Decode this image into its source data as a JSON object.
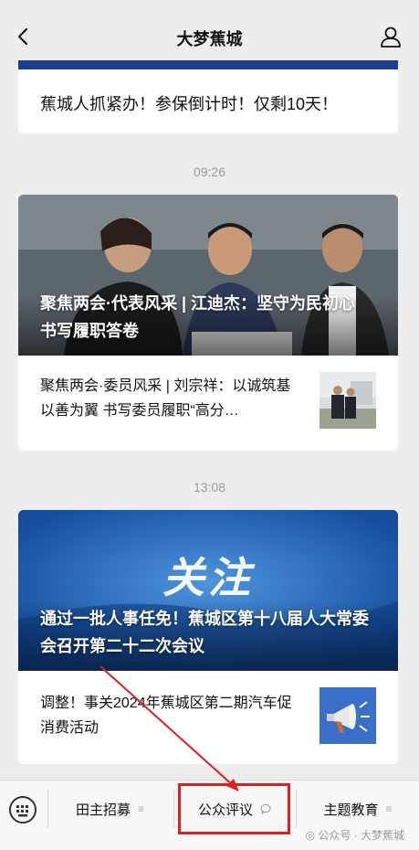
{
  "nav": {
    "title": "大梦蕉城"
  },
  "feed": {
    "top_card_title": "蕉城人抓紧办！参保倒计时！仅剩10天！",
    "groups": [
      {
        "time": "09:26",
        "cover_title": "聚焦两会·代表风采 | 江迪杰：坚守为民初心 书写履职答卷",
        "sub_title": "聚焦两会·委员风采 | 刘宗祥：以诚筑基 以善为翼 书写委员履职“高分…"
      },
      {
        "time": "13:08",
        "cover_badge": "关注",
        "cover_title": "通过一批人事任免！蕉城区第十八届人大常委会召开第二十二次会议",
        "sub_title": "调整！事关2024年蕉城区第二期汽车促消费活动"
      }
    ]
  },
  "bottom_menu": {
    "items": [
      {
        "label": "田主招募",
        "icon": "menu-lines-icon"
      },
      {
        "label": "公众评议",
        "icon": "comment-bubble-icon"
      },
      {
        "label": "主题教育",
        "icon": "menu-lines-icon"
      }
    ],
    "watermark": "公众号 · 大梦蕉城"
  },
  "colors": {
    "highlight": "#e02020",
    "bar": "#1f3f8a"
  }
}
